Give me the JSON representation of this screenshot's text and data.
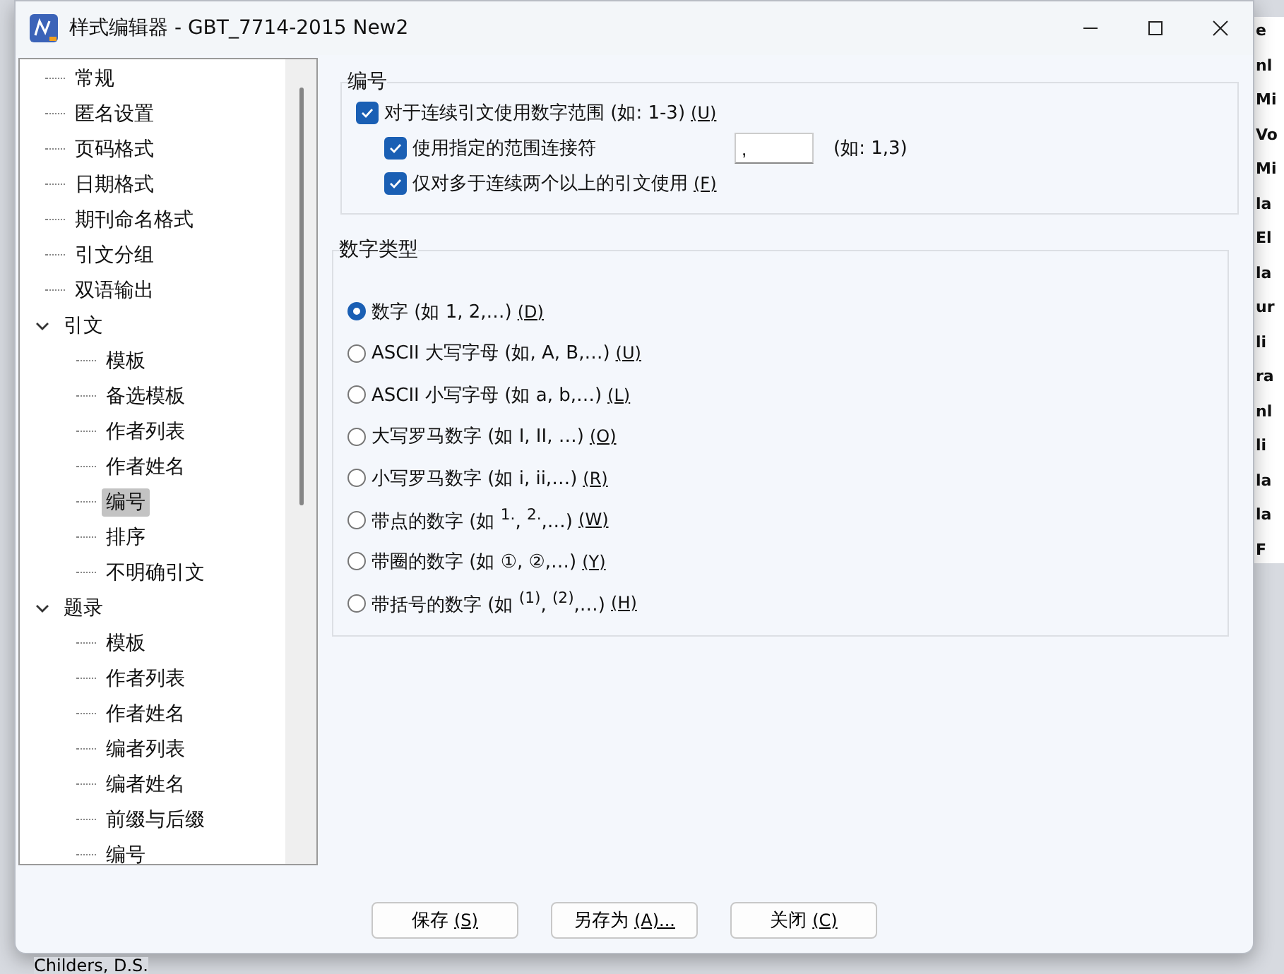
{
  "background": {
    "edge_fragments": [
      "e",
      "nl",
      "Mi",
      "Vo",
      "Mi",
      "la",
      "El",
      "la",
      "ur",
      "li",
      "ra",
      "nl",
      "li",
      "la",
      "la",
      "F"
    ],
    "bottom_text": "Childers, D.S."
  },
  "window": {
    "title": "样式编辑器 - GBT_7714-2015 New2"
  },
  "tree": [
    {
      "label": "常规",
      "selected": false
    },
    {
      "label": "匿名设置",
      "selected": false
    },
    {
      "label": "页码格式",
      "selected": false
    },
    {
      "label": "日期格式",
      "selected": false
    },
    {
      "label": "期刊命名格式",
      "selected": false
    },
    {
      "label": "引文分组",
      "selected": false
    },
    {
      "label": "双语输出",
      "selected": false
    },
    {
      "label": "引文",
      "selected": false,
      "expanded": true,
      "children": [
        {
          "label": "模板",
          "selected": false
        },
        {
          "label": "备选模板",
          "selected": false
        },
        {
          "label": "作者列表",
          "selected": false
        },
        {
          "label": "作者姓名",
          "selected": false
        },
        {
          "label": "编号",
          "selected": true
        },
        {
          "label": "排序",
          "selected": false
        },
        {
          "label": "不明确引文",
          "selected": false
        }
      ]
    },
    {
      "label": "题录",
      "selected": false,
      "expanded": true,
      "children": [
        {
          "label": "模板",
          "selected": false
        },
        {
          "label": "作者列表",
          "selected": false
        },
        {
          "label": "作者姓名",
          "selected": false
        },
        {
          "label": "编者列表",
          "selected": false
        },
        {
          "label": "编者姓名",
          "selected": false
        },
        {
          "label": "前缀与后缀",
          "selected": false
        },
        {
          "label": "编号",
          "selected": false
        }
      ]
    }
  ],
  "numbering": {
    "title": "编号",
    "options": [
      {
        "label": "对于连续引文使用数字范围 (如: 1-3)",
        "shortcut": "(U)",
        "checked": true,
        "nested": false
      },
      {
        "label": "使用指定的范围连接符",
        "checked": true,
        "nested": true,
        "value": ",",
        "hint": "(如: 1,3)"
      },
      {
        "label": "仅对多于连续两个以上的引文使用",
        "shortcut": "(F)",
        "checked": true,
        "nested": true
      }
    ]
  },
  "number_type": {
    "title": "数字类型",
    "options": [
      {
        "label": "数字 (如 1, 2,…)",
        "shortcut": "(D)",
        "selected": true
      },
      {
        "label": "ASCII 大写字母 (如, A, B,…)",
        "shortcut": "(U)",
        "selected": false
      },
      {
        "label": "ASCII 小写字母 (如 a, b,…)",
        "shortcut": "(L)",
        "selected": false
      },
      {
        "label": "大写罗马数字 (如 I, II, …)",
        "shortcut": "(O)",
        "selected": false
      },
      {
        "label": "小写罗马数字 (如 i, ii,…)",
        "shortcut": "(R)",
        "selected": false
      },
      {
        "label": "带点的数字 (如 $^{1.}$, $^{2.}$,…)",
        "shortcut": "(W)",
        "selected": false
      },
      {
        "label": "带圈的数字 (如 ①, ②,…)",
        "shortcut": "(Y)",
        "selected": false
      },
      {
        "label": "带括号的数字 (如 $^{(1)}$, $^{(2)}$,…)",
        "shortcut": "(H)",
        "selected": false
      }
    ]
  },
  "buttons": [
    {
      "label": "保存",
      "shortcut": "(S)"
    },
    {
      "label": "另存为",
      "shortcut": "(A)..."
    },
    {
      "label": "关闭",
      "shortcut": "(C)"
    }
  ]
}
